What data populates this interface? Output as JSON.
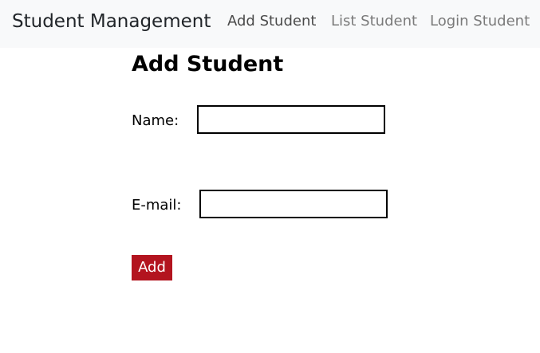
{
  "navbar": {
    "brand": "Student Management",
    "links": [
      {
        "label": "Add Student"
      },
      {
        "label": "List Student"
      },
      {
        "label": "Login Student"
      }
    ]
  },
  "main": {
    "title": "Add Student",
    "form": {
      "name_label": "Name:",
      "name_value": "",
      "email_label": "E-mail:",
      "email_value": "",
      "submit_label": "Add"
    }
  },
  "colors": {
    "navbar_bg": "#f8f9fa",
    "button_bg": "#b3141f",
    "button_text": "#ffffff"
  }
}
